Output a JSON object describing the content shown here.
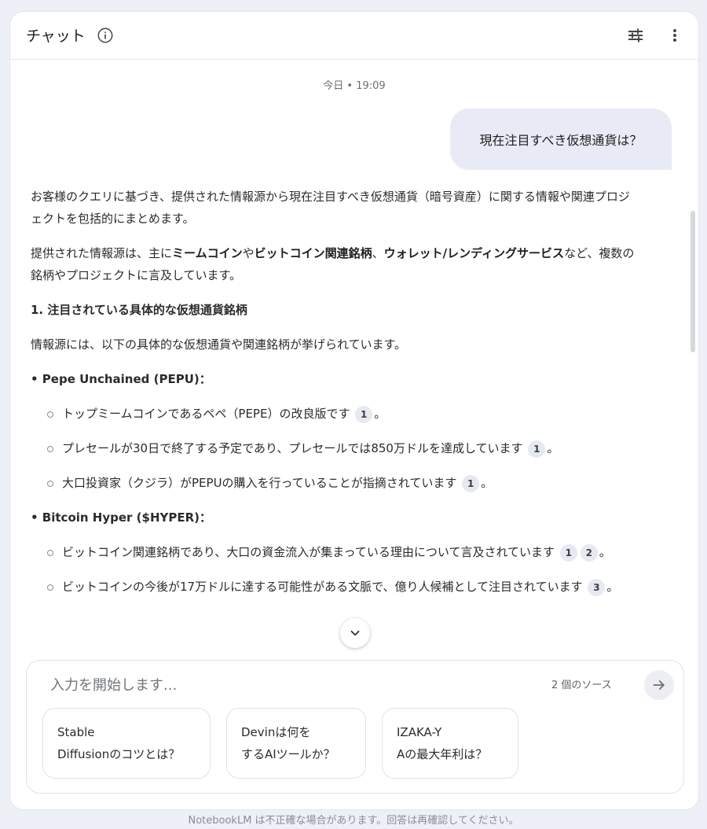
{
  "header": {
    "title": "チャット",
    "icons": {
      "info": "info-icon",
      "tune": "tune-icon",
      "more": "more-vert-icon"
    }
  },
  "chat": {
    "timestamp": "今日 • 19:09",
    "user_message": "現在注目すべき仮想通貨は？",
    "response": {
      "intro": "お客様のクエリに基づき、提供された情報源から現在注目すべき仮想通貨（暗号資産）に関する情報や関連プロジェクトを包括的にまとめます。",
      "para2_a": "提供された情報源は、主に",
      "para2_b1": "ミームコイン",
      "para2_c": "や",
      "para2_b2": "ビットコイン関連銘柄",
      "para2_d": "、",
      "para2_b3": "ウォレット/レンディングサービス",
      "para2_e": "など、複数の銘柄やプロジェクトに言及しています。",
      "section1": "1. 注目されている具体的な仮想通貨銘柄",
      "section1_intro": "情報源には、以下の具体的な仮想通貨や関連銘柄が挙げられています。",
      "pepu_title": "• Pepe Unchained (PEPU)：",
      "pepu_1": "トップミームコインであるペペ（PEPE）の改良版です",
      "pepu_2": "プレセールが30日で終了する予定であり、プレセールでは850万ドルを達成しています",
      "pepu_3": "大口投資家（クジラ）がPEPUの購入を行っていることが指摘されています",
      "hyper_title": "• Bitcoin Hyper ($HYPER)：",
      "hyper_1": "ビットコイン関連銘柄であり、大口の資金流入が集まっている理由について言及されています",
      "hyper_2": "ビットコインの今後が17万ドルに達する可能性がある文脈で、億り人候補として注目されています",
      "period": "。",
      "cites": {
        "c1": "1",
        "c2": "2",
        "c3": "3"
      }
    }
  },
  "composer": {
    "placeholder": "入力を開始します...",
    "source_count": "2 個のソース",
    "send_icon": "arrow-right-icon"
  },
  "suggestions": [
    {
      "line1": "Stable",
      "line2": "Diffusionのコツとは？"
    },
    {
      "line1": "Devinは何を",
      "line2": "するAIツールか？"
    },
    {
      "line1": "IZAKA-Y",
      "line2": "Aの最大年利は？"
    }
  ],
  "footer": {
    "disclaimer": "NotebookLM は不正確な場合があります。回答は再確認してください。"
  }
}
